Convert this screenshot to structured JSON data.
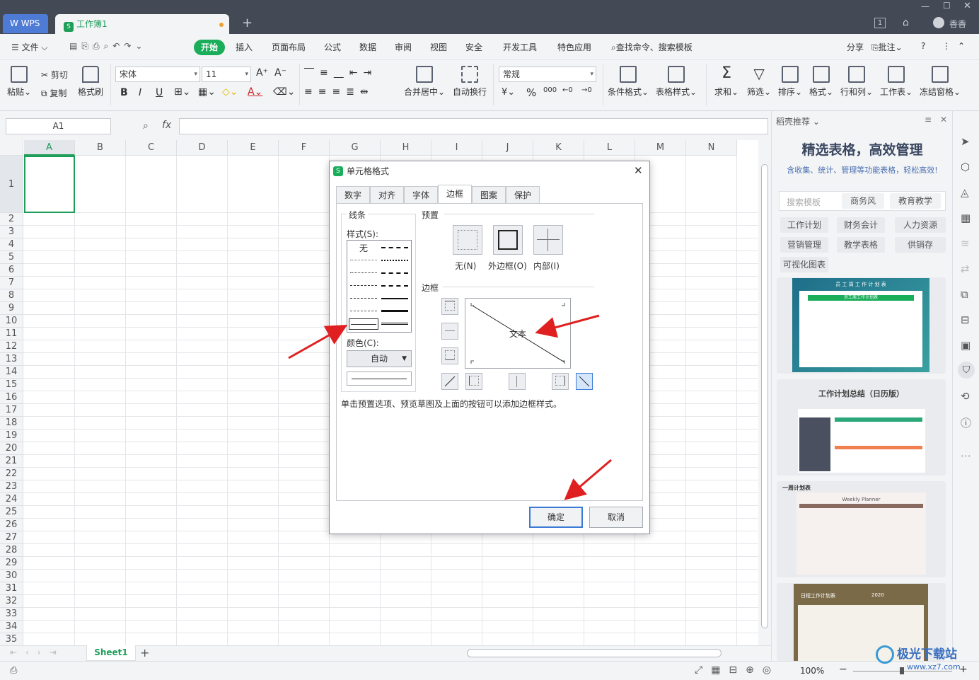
{
  "titlebar": {
    "wps_label": "WPS",
    "doc_tab": "工作簿1",
    "new_tab": "+",
    "user": "香香",
    "badge": "1"
  },
  "menu": {
    "file": "文件",
    "start": "开始",
    "items": [
      "插入",
      "页面布局",
      "公式",
      "数据",
      "审阅",
      "视图",
      "安全",
      "开发工具",
      "特色应用"
    ],
    "search": "查找命令、搜索模板",
    "share": "分享",
    "comment": "批注"
  },
  "ribbon": {
    "paste": "粘贴",
    "cut": "剪切",
    "copy": "复制",
    "format_painter": "格式刷",
    "font_name": "宋体",
    "font_size": "11",
    "bold": "B",
    "italic": "I",
    "underline": "U",
    "merge_center": "合并居中",
    "wrap_text": "自动换行",
    "number_format": "常规",
    "percent": "%",
    "thousands": "000",
    "cond_format": "条件格式",
    "table_style": "表格样式",
    "sum": "求和",
    "filter": "筛选",
    "sort": "排序",
    "format": "格式",
    "row_col": "行和列",
    "worksheet": "工作表",
    "freeze": "冻结窗格"
  },
  "formula": {
    "name_box": "A1",
    "fx": "fx"
  },
  "grid": {
    "columns": [
      "A",
      "B",
      "C",
      "D",
      "E",
      "F",
      "G",
      "H",
      "I",
      "J",
      "K",
      "L",
      "M",
      "N"
    ],
    "rows": [
      "1",
      "2",
      "3",
      "4",
      "5",
      "6",
      "7",
      "8",
      "9",
      "10",
      "11",
      "12",
      "13",
      "14",
      "15",
      "16",
      "17",
      "18",
      "19",
      "20",
      "21",
      "22",
      "23",
      "24",
      "25",
      "26",
      "27",
      "28",
      "29",
      "30",
      "31",
      "32",
      "33",
      "34",
      "35"
    ]
  },
  "sheets": {
    "active": "Sheet1",
    "add": "+"
  },
  "status": {
    "zoom": "100%"
  },
  "right_panel": {
    "header": "稻壳推荐",
    "headline": "精选表格，高效管理",
    "sub": "含收集、统计、管理等功能表格，轻松高效!",
    "search_placeholder": "搜索模板",
    "chip_top": [
      "商务风",
      "教育教学"
    ],
    "categories": [
      "工作计划",
      "财务会计",
      "人力资源",
      "营销管理",
      "教学表格",
      "供销存",
      "可视化图表"
    ],
    "thumb1_title": "员 工 周 工 作 计 划 表",
    "thumb1_inner": "员工周工作计划表",
    "thumb2_title": "工作计划总结（日历版）",
    "thumb3_title": "一周计划表",
    "thumb3_sub": "Weekly  Planner",
    "thumb4_title": "日程工作计划表",
    "thumb4_year": "2020"
  },
  "dialog": {
    "title": "单元格格式",
    "tabs": [
      "数字",
      "对齐",
      "字体",
      "边框",
      "图案",
      "保护"
    ],
    "active_tab": "边框",
    "line_group": "线条",
    "style_label": "样式(S):",
    "none_style": "无",
    "color_label": "颜色(C):",
    "color_value": "自动",
    "preset_group": "预置",
    "preset_none": "无(N)",
    "preset_outline": "外边框(O)",
    "preset_inside": "内部(I)",
    "border_group": "边框",
    "preview_text": "文本",
    "hint": "单击预置选项、预览草图及上面的按钮可以添加边框样式。",
    "ok": "确定",
    "cancel": "取消"
  },
  "watermark": {
    "text": "极光下载站",
    "url": "www.xz7.com"
  },
  "colors": {
    "accent_green": "#1aad5a",
    "titlebar": "#434a56",
    "arrow_red": "#e02020",
    "dialog_focus": "#3b7bd6"
  }
}
